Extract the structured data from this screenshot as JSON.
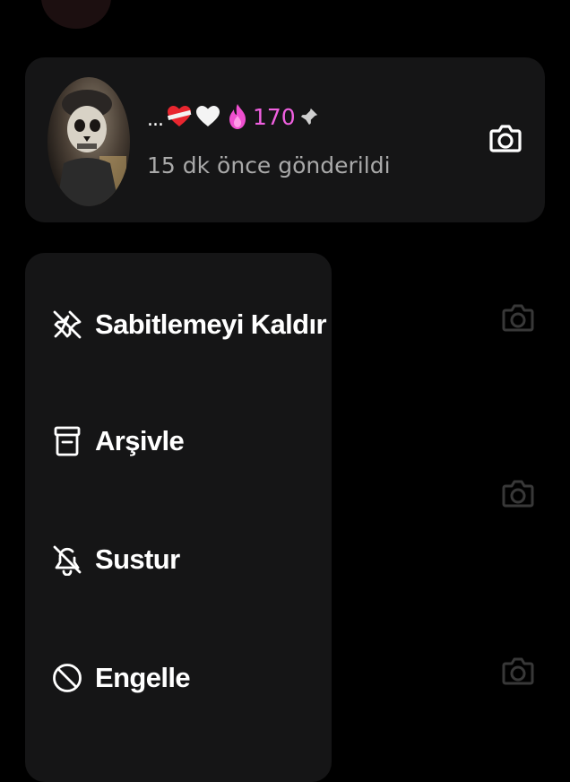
{
  "pinned_chat": {
    "name_prefix": "...",
    "emojis": [
      "broken-heart",
      "white-heart"
    ],
    "streak_icon": "fire-icon",
    "streak_count": "170",
    "pin_icon": "pin-icon",
    "status_text": "15 dk önce gönderildi",
    "camera_icon": "camera-icon"
  },
  "context_menu": {
    "items": [
      {
        "icon": "unpin-icon",
        "label": "Sabitlemeyi Kaldır"
      },
      {
        "icon": "archive-icon",
        "label": "Arşivle"
      },
      {
        "icon": "mute-bell-icon",
        "label": "Sustur"
      },
      {
        "icon": "block-icon",
        "label": "Engelle"
      }
    ]
  },
  "colors": {
    "background": "#000000",
    "card": "#151516",
    "streak_accent": "#f060e0",
    "secondary_text": "#a9a9a9"
  }
}
